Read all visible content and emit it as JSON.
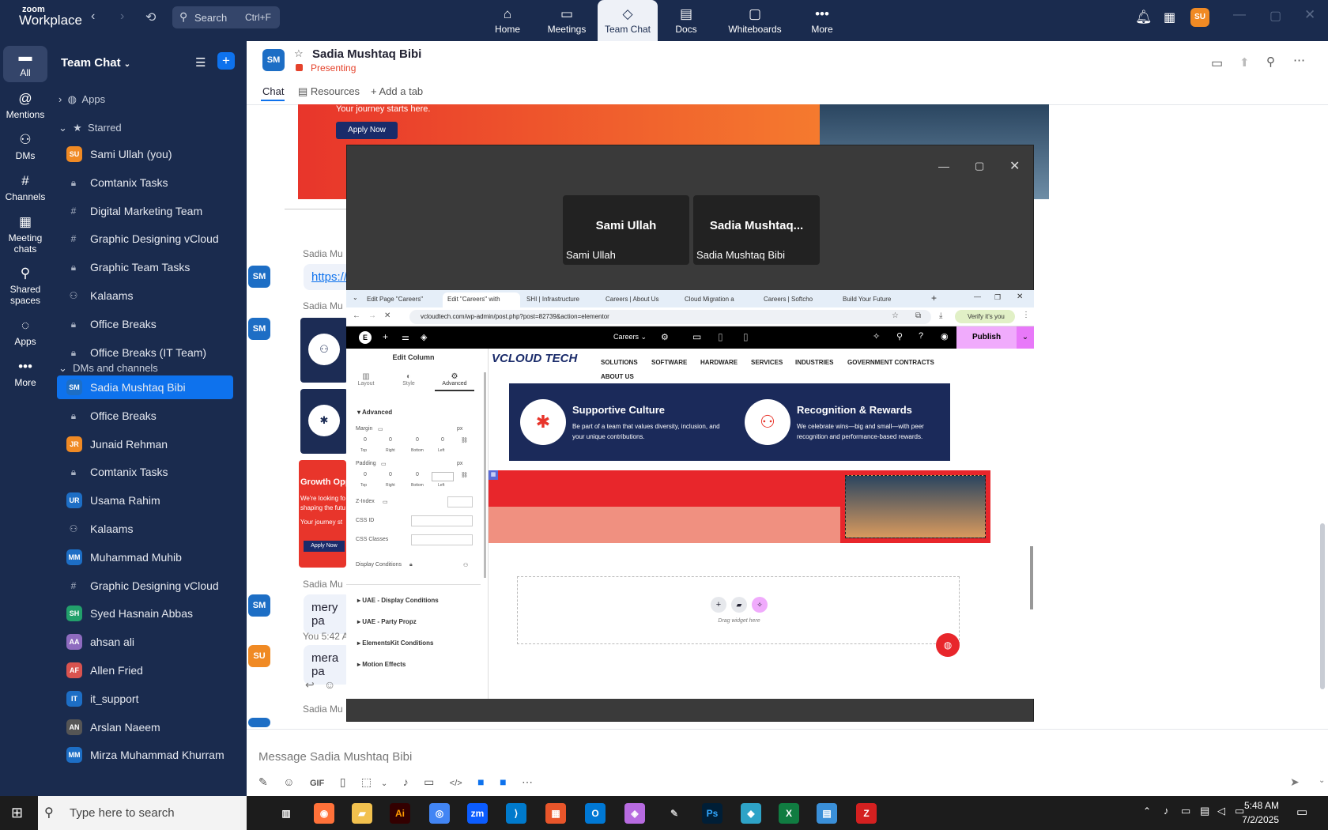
{
  "app": {
    "brand_top": "zoom",
    "brand_bottom": "Workplace"
  },
  "search": {
    "label": "Search",
    "shortcut": "Ctrl+F"
  },
  "top_tabs": [
    {
      "label": "Home",
      "icon": "⌂"
    },
    {
      "label": "Meetings",
      "icon": "▭"
    },
    {
      "label": "Team Chat",
      "icon": "◇"
    },
    {
      "label": "Docs",
      "icon": "▤"
    },
    {
      "label": "Whiteboards",
      "icon": "▢"
    },
    {
      "label": "More",
      "icon": "•••"
    }
  ],
  "user_avatar": "SU",
  "rail": [
    {
      "label": "All",
      "icon": "▬"
    },
    {
      "label": "Mentions",
      "icon": "@"
    },
    {
      "label": "DMs",
      "icon": "⚇"
    },
    {
      "label": "Channels",
      "icon": "#"
    },
    {
      "label": "Meeting chats",
      "icon": "▦"
    },
    {
      "label": "Shared spaces",
      "icon": "⚲"
    },
    {
      "label": "Apps",
      "icon": "◌"
    },
    {
      "label": "More",
      "icon": "•••"
    }
  ],
  "sidebar": {
    "title": "Team Chat",
    "sections": {
      "apps": "Apps",
      "starred": "Starred",
      "dms": "DMs and channels"
    },
    "starred": [
      {
        "label": "Sami Ullah (you)",
        "kind": "avatar",
        "initials": "SU",
        "color": "#f08a24"
      },
      {
        "label": "Comtanix Tasks",
        "kind": "lock"
      },
      {
        "label": "Digital Marketing Team",
        "kind": "hash"
      },
      {
        "label": "Graphic Designing vCloud",
        "kind": "hash"
      },
      {
        "label": "Graphic Team Tasks",
        "kind": "lock"
      },
      {
        "label": "Kalaams",
        "kind": "group"
      },
      {
        "label": "Office Breaks",
        "kind": "lock"
      },
      {
        "label": "Office Breaks (IT Team)",
        "kind": "lock"
      }
    ],
    "dms": [
      {
        "label": "Sadia Mushtaq Bibi",
        "kind": "avatar",
        "initials": "SM",
        "color": "#1d6ec5"
      },
      {
        "label": "Office Breaks",
        "kind": "lock"
      },
      {
        "label": "Junaid Rehman",
        "kind": "avatar",
        "initials": "JR",
        "color": "#f08a24"
      },
      {
        "label": "Comtanix Tasks",
        "kind": "lock"
      },
      {
        "label": "Usama Rahim",
        "kind": "avatar",
        "initials": "UR",
        "color": "#1d6ec5"
      },
      {
        "label": "Kalaams",
        "kind": "group"
      },
      {
        "label": "Muhammad Muhib",
        "kind": "avatar",
        "initials": "MM",
        "color": "#1d6ec5"
      },
      {
        "label": "Graphic Designing vCloud",
        "kind": "hash"
      },
      {
        "label": "Syed Hasnain Abbas",
        "kind": "avatar",
        "initials": "SH",
        "color": "#22a06b"
      },
      {
        "label": "ahsan ali",
        "kind": "avatar",
        "initials": "AA",
        "color": "#8e6bbf"
      },
      {
        "label": "Allen Fried",
        "kind": "avatar",
        "initials": "AF",
        "color": "#d9534f"
      },
      {
        "label": "it_support",
        "kind": "avatar",
        "initials": "IT",
        "color": "#1d6ec5"
      },
      {
        "label": "Arslan Naeem",
        "kind": "avatar",
        "initials": "AN",
        "color": "#555"
      },
      {
        "label": "Mirza Muhammad Khurram",
        "kind": "avatar",
        "initials": "MM",
        "color": "#1d6ec5"
      }
    ]
  },
  "chat": {
    "avatar": "SM",
    "name": "Sadia Mushtaq Bibi",
    "status": "Presenting",
    "tabs": [
      "Chat",
      "Resources",
      "Add a tab"
    ],
    "banner_line": "Your journey starts here.",
    "banner_button": "Apply Now",
    "sender": "Sadia Mu",
    "link_fragment": "https://",
    "growth_text": "Growth Opp",
    "growth_sub1": "We're looking fo",
    "growth_sub2": "shaping the futu",
    "growth_sub3": "Your journey st",
    "growth_btn": "Apply Now",
    "msg1": "mery pa",
    "you_label": "You 5:42 A",
    "you_avatar": "SU",
    "msg2": "mera pa",
    "composer_placeholder": "Message Sadia Mushtaq Bibi"
  },
  "share": {
    "tile1_name": "Sami Ullah",
    "tile1_label": "Sami Ullah",
    "tile2_name": "Sadia  Mushtaq...",
    "tile2_label": "Sadia Mushtaq Bibi"
  },
  "browser": {
    "tabs": [
      "Edit Page \"Careers\"",
      "Edit \"Careers\" with",
      "SHI | Infrastructure",
      "Careers | About Us",
      "Cloud Migration a",
      "Careers | Softcho",
      "Build Your Future"
    ],
    "url": "vcloudtech.com/wp-admin/post.php?post=82739&action=elementor",
    "verify": "Verify it's you"
  },
  "elementor": {
    "page_select": "Careers",
    "publish": "Publish",
    "panel_title": "Edit Column",
    "panel_tabs": [
      "Layout",
      "Style",
      "Advanced"
    ],
    "section": "Advanced",
    "margin": "Margin",
    "padding": "Padding",
    "dims": [
      "Top",
      "Right",
      "Bottom",
      "Left"
    ],
    "zero": "0",
    "unit": "px",
    "zindex": "Z-Index",
    "cssid": "CSS ID",
    "cssclasses": "CSS Classes",
    "display_conditions": "Display Conditions",
    "accordions": [
      "UAE - Display Conditions",
      "UAE - Party Propz",
      "ElementsKit Conditions",
      "Motion Effects"
    ]
  },
  "site": {
    "logo": "VCLOUD TECH",
    "nav": [
      "SOLUTIONS",
      "SOFTWARE",
      "HARDWARE",
      "SERVICES",
      "INDUSTRIES",
      "GOVERNMENT CONTRACTS",
      "ABOUT US"
    ],
    "card1_title": "Supportive Culture",
    "card1_text": "Be part of a team that values diversity, inclusion, and your unique contributions.",
    "card2_title": "Recognition & Rewards",
    "card2_text": "We celebrate wins—big and small—with peer recognition and performance-based rewards.",
    "drag_text": "Drag widget here"
  },
  "taskbar": {
    "search_placeholder": "Type here to search",
    "time": "5:48 AM",
    "date": "7/2/2025"
  }
}
